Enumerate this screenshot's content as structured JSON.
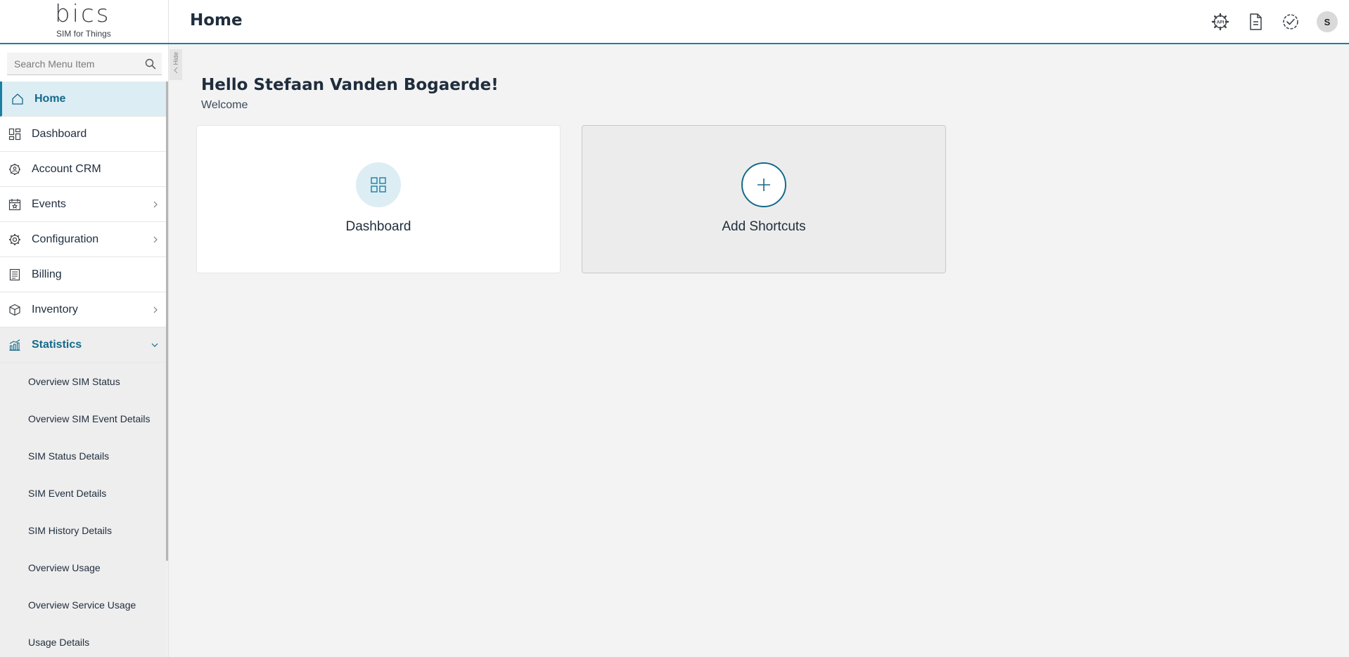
{
  "header": {
    "brand": "bics",
    "tagline": "SIM for Things",
    "title": "Home",
    "icons": [
      "api-settings-icon",
      "document-icon",
      "check-circle-icon"
    ],
    "avatar_initial": "S"
  },
  "sidebar": {
    "search_placeholder": "Search Menu Item",
    "hide_label": "Hide",
    "items": [
      {
        "label": "Home",
        "icon": "home-icon",
        "state": "active"
      },
      {
        "label": "Dashboard",
        "icon": "dashboard-icon"
      },
      {
        "label": "Account CRM",
        "icon": "account-icon"
      },
      {
        "label": "Events",
        "icon": "events-icon",
        "chevron": "right"
      },
      {
        "label": "Configuration",
        "icon": "gear-icon",
        "chevron": "right"
      },
      {
        "label": "Billing",
        "icon": "billing-icon"
      },
      {
        "label": "Inventory",
        "icon": "box-icon",
        "chevron": "right"
      },
      {
        "label": "Statistics",
        "icon": "chart-icon",
        "chevron": "down",
        "state": "expanded"
      }
    ],
    "statistics_subitems": [
      "Overview SIM Status",
      "Overview SIM Event Details",
      "SIM Status Details",
      "SIM Event Details",
      "SIM History Details",
      "Overview Usage",
      "Overview Service Usage",
      "Usage Details"
    ]
  },
  "main": {
    "greeting": "Hello Stefaan Vanden Bogaerde!",
    "welcome": "Welcome",
    "cards": [
      {
        "label": "Dashboard",
        "icon": "dashboard-icon"
      },
      {
        "label": "Add Shortcuts",
        "icon": "plus-icon"
      }
    ]
  },
  "colors": {
    "accent": "#146a8b",
    "accent_light": "#ddedf4",
    "background": "#f3f3f3"
  }
}
